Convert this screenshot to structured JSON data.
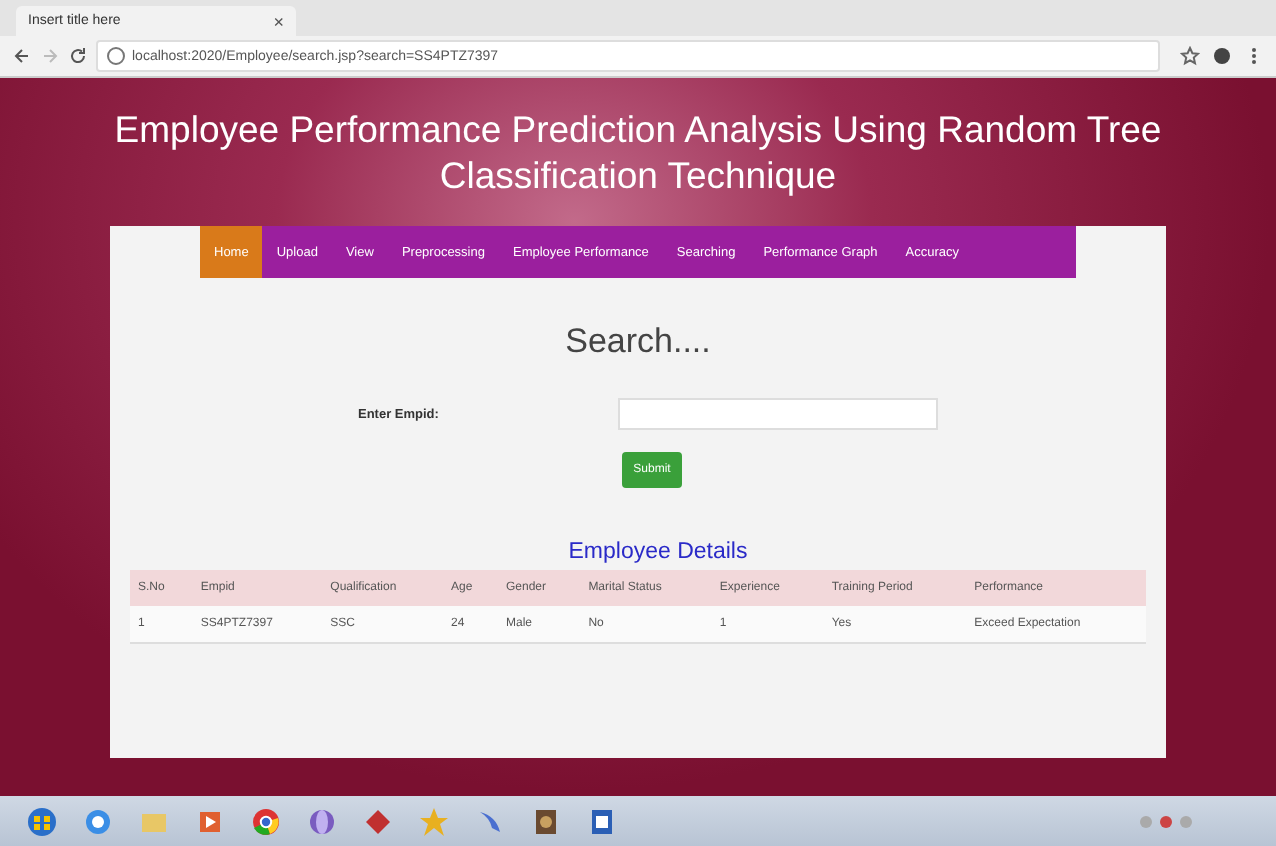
{
  "browser": {
    "tab_title": "Insert title here",
    "tab_close": "×",
    "url": "localhost:2020/Employee/search.jsp?search=SS4PTZ7397"
  },
  "page": {
    "title": "Employee Performance Prediction Analysis Using Random Tree Classification Technique"
  },
  "nav": [
    {
      "label": "Home",
      "selected": true
    },
    {
      "label": "Upload",
      "selected": false
    },
    {
      "label": "View",
      "selected": false
    },
    {
      "label": "Preprocessing",
      "selected": false
    },
    {
      "label": "Employee Performance",
      "selected": false
    },
    {
      "label": "Searching",
      "selected": false
    },
    {
      "label": "Performance Graph",
      "selected": false
    },
    {
      "label": "Accuracy",
      "selected": false
    }
  ],
  "search": {
    "heading": "Search....",
    "label": "Enter Empid:",
    "submit": "Submit"
  },
  "table": {
    "title": "Employee Details",
    "columns": [
      "S.No",
      "Empid",
      "Qualification",
      "Age",
      "Gender",
      "Marital Status",
      "Experience",
      "Training Period",
      "Performance"
    ],
    "rows": [
      [
        "1",
        "SS4PTZ7397",
        "SSC",
        "24",
        "Male",
        "No",
        "1",
        "Yes",
        "Exceed Expectation"
      ]
    ]
  },
  "taskbar": {
    "apps": [
      {
        "kind": "start"
      },
      {
        "kind": "ie"
      },
      {
        "kind": "folder"
      },
      {
        "kind": "media"
      },
      {
        "kind": "chrome"
      },
      {
        "kind": "globe"
      },
      {
        "kind": "diamond"
      },
      {
        "kind": "star"
      },
      {
        "kind": "arrow"
      },
      {
        "kind": "book"
      },
      {
        "kind": "word"
      }
    ]
  }
}
